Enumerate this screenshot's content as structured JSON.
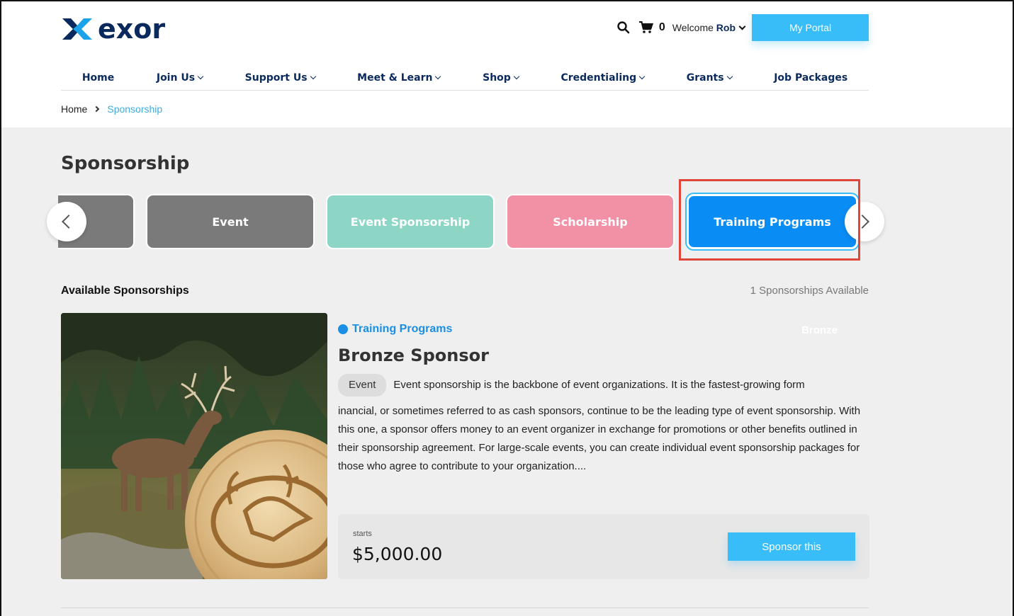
{
  "brand": {
    "name": "exor"
  },
  "topbar": {
    "cart_count": "0",
    "welcome_prefix": "Welcome",
    "user_name": "Rob",
    "portal_label": "My Portal"
  },
  "nav": {
    "items": [
      {
        "label": "Home"
      },
      {
        "label": "Join Us"
      },
      {
        "label": "Support Us"
      },
      {
        "label": "Meet & Learn"
      },
      {
        "label": "Shop"
      },
      {
        "label": "Credentialing"
      },
      {
        "label": "Grants"
      },
      {
        "label": "Job Packages"
      }
    ]
  },
  "breadcrumb": {
    "home": "Home",
    "current": "Sponsorship"
  },
  "page": {
    "title": "Sponsorship"
  },
  "categories": [
    {
      "label": "",
      "color": "#7a7a7a"
    },
    {
      "label": "Event",
      "color": "#7a7a7a"
    },
    {
      "label": "Event Sponsorship",
      "color": "#8dd6c6"
    },
    {
      "label": "Scholarship",
      "color": "#f290a5"
    },
    {
      "label": "Training Programs",
      "color": "#0a8cf5"
    }
  ],
  "available": {
    "title": "Available Sponsorships",
    "count_text": "1 Sponsorships Available"
  },
  "sponsorship": {
    "category": "Training Programs",
    "tier": "Bronze",
    "title": "Bronze Sponsor",
    "tag": "Event",
    "desc_first": "Event sponsorship is the backbone of event organizations. It is the fastest-growing form",
    "desc_rest": "inancial, or sometimes referred to as cash sponsors, continue to be the leading type of event sponsorship. With this one, a sponsor offers money to an event organizer in exchange for promotions or other benefits outlined in their sponsorship agreement. For large-scale events, you can create individual event sponsorship packages for those who agree to contribute to your organization....",
    "starts_label": "starts",
    "price": "$5,000.00",
    "button_label": "Sponsor this"
  },
  "colors": {
    "accent": "#38bdf8",
    "nav_text": "#0a2a5e",
    "link": "#3aaee0",
    "highlight": "#e0453a"
  }
}
